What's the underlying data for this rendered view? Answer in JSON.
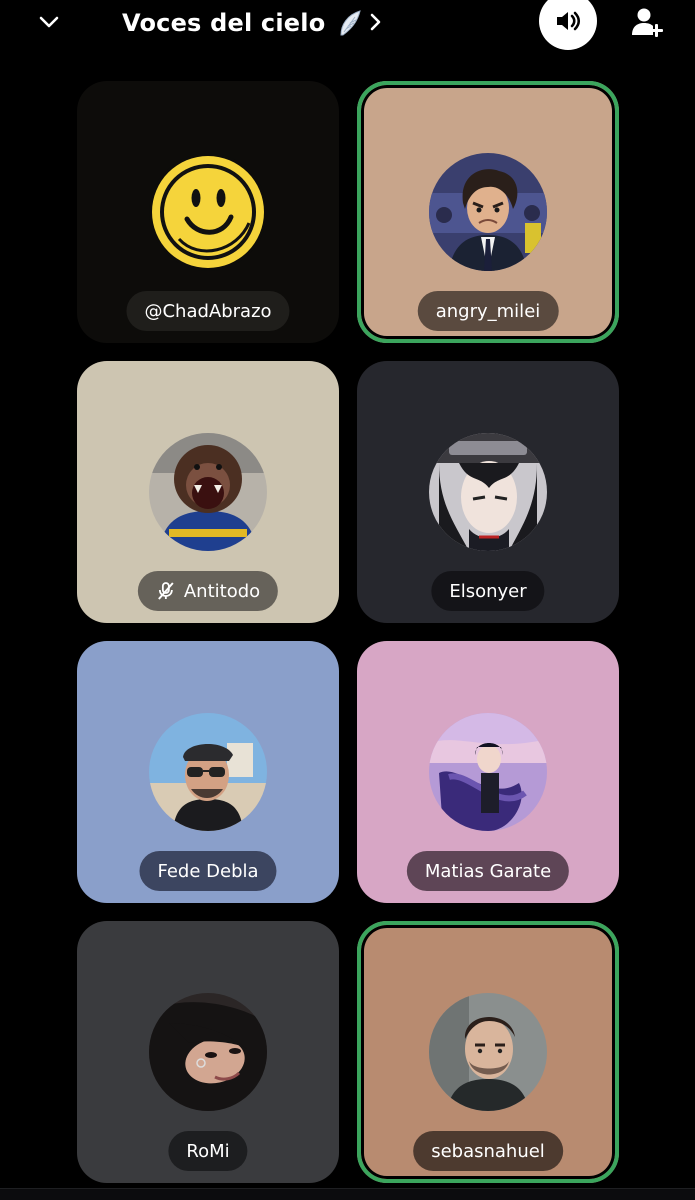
{
  "header": {
    "title": "Voces del cielo",
    "title_emoji_icon": "wing-icon",
    "back_icon": "chevron-down-icon",
    "next_icon": "chevron-right-icon",
    "speaker_icon": "speaker-icon",
    "add_user_icon": "add-user-icon"
  },
  "colors": {
    "background": "#000000",
    "speaking_ring": "#3ba55d",
    "tile_chadabrazo": "#0d0c0a",
    "tile_angry_milei": "#c8a58b",
    "tile_antitodo": "#cdc5b1",
    "tile_elsonyer": "#26272d",
    "tile_fede_debla": "#8a9fca",
    "tile_matias_garate": "#d7a6c5",
    "tile_romi": "#3a3b3e",
    "tile_sebasnahuel": "#b88b70"
  },
  "participants": [
    {
      "name": "@ChadAbrazo",
      "speaking": false,
      "muted": false
    },
    {
      "name": "angry_milei",
      "speaking": true,
      "muted": false
    },
    {
      "name": "Antitodo",
      "speaking": false,
      "muted": true
    },
    {
      "name": "Elsonyer",
      "speaking": false,
      "muted": false
    },
    {
      "name": "Fede Debla",
      "speaking": false,
      "muted": false
    },
    {
      "name": "Matias Garate",
      "speaking": false,
      "muted": false
    },
    {
      "name": "RoMi",
      "speaking": false,
      "muted": false
    },
    {
      "name": "sebasnahuel",
      "speaking": true,
      "muted": false
    }
  ]
}
